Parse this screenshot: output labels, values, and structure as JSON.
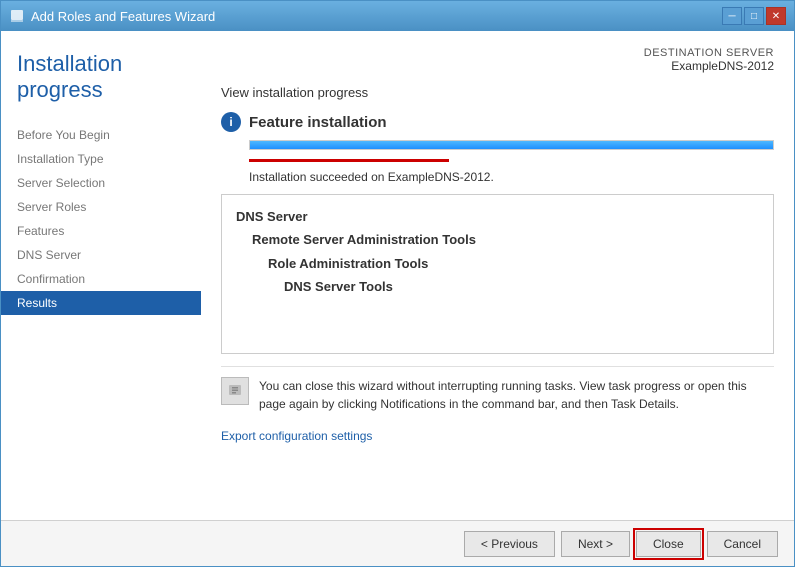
{
  "window": {
    "title": "Add Roles and Features Wizard",
    "icon": "📋"
  },
  "titlebar": {
    "minimize_label": "─",
    "maximize_label": "□",
    "close_label": "✕"
  },
  "sidebar": {
    "page_title": "Installation progress",
    "items": [
      {
        "label": "Before You Begin",
        "active": false
      },
      {
        "label": "Installation Type",
        "active": false
      },
      {
        "label": "Server Selection",
        "active": false
      },
      {
        "label": "Server Roles",
        "active": false
      },
      {
        "label": "Features",
        "active": false
      },
      {
        "label": "DNS Server",
        "active": false
      },
      {
        "label": "Confirmation",
        "active": false
      },
      {
        "label": "Results",
        "active": true
      }
    ]
  },
  "content": {
    "destination_label": "DESTINATION SERVER",
    "destination_server": "ExampleDNS-2012",
    "view_progress_label": "View installation progress",
    "feature_installation_title": "Feature installation",
    "progress_percent": 100,
    "success_message": "Installation succeeded on ExampleDNS-2012.",
    "features": [
      {
        "label": "DNS Server",
        "level": 1
      },
      {
        "label": "Remote Server Administration Tools",
        "level": 2
      },
      {
        "label": "Role Administration Tools",
        "level": 3
      },
      {
        "label": "DNS Server Tools",
        "level": 4
      }
    ],
    "notification_text": "You can close this wizard without interrupting running tasks. View task progress or open this page again by clicking Notifications in the command bar, and then Task Details.",
    "export_link": "Export configuration settings"
  },
  "buttons": {
    "previous_label": "< Previous",
    "next_label": "Next >",
    "close_label": "Close",
    "cancel_label": "Cancel"
  }
}
